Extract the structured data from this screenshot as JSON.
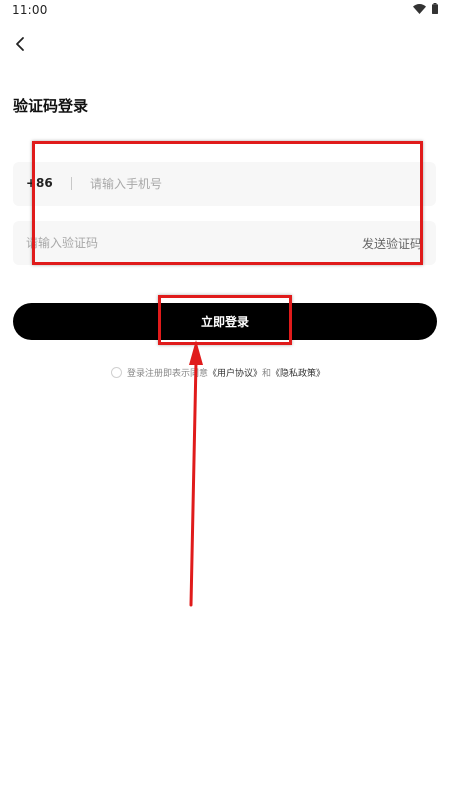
{
  "status_bar": {
    "time": "11:00",
    "icons": [
      "wifi-icon",
      "battery-icon"
    ]
  },
  "header": {
    "back_icon": "chevron-left-icon"
  },
  "title": "验证码登录",
  "phone": {
    "country_code": "+86",
    "placeholder": "请输入手机号",
    "value": ""
  },
  "code": {
    "placeholder": "请输入验证码",
    "value": "",
    "send_label": "发送验证码"
  },
  "login_button": {
    "label": "立即登录"
  },
  "agreement": {
    "prefix": "登录注册即表示同意",
    "user_agreement": "《用户协议》",
    "and": "和",
    "privacy_policy": "《隐私政策》",
    "checked": false
  },
  "colors": {
    "accent": "#000000",
    "annotation": "#e01b1b",
    "input_bg": "#f7f7f7"
  }
}
